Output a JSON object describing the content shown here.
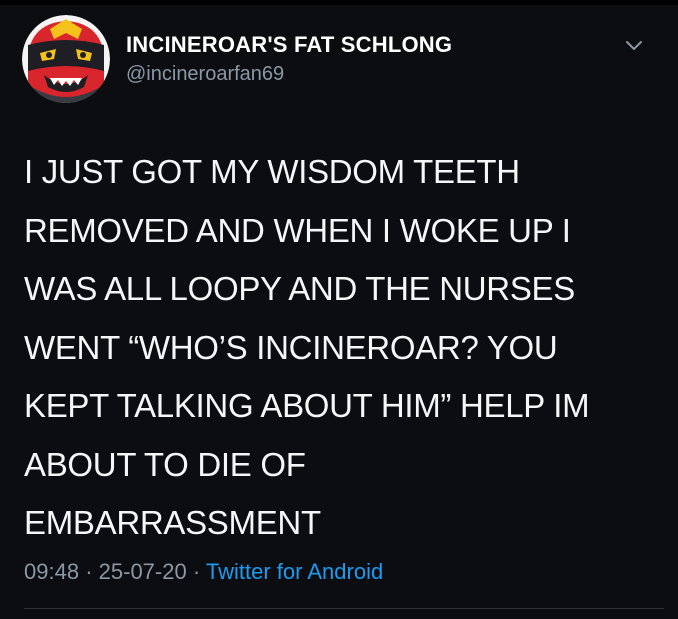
{
  "tweet": {
    "display_name": "INCINEROAR'S FAT SCHLONG",
    "handle": "@incineroarfan69",
    "text": "I JUST GOT MY WISDOM TEETH\nREMOVED AND WHEN I WOKE UP I\nWAS ALL LOOPY AND THE NURSES\nWENT “WHO’S INCINEROAR? YOU\nKEPT TALKING ABOUT HIM” HELP IM\nABOUT TO DIE OF\nEMBARRASSMENT",
    "time": "09:48",
    "separator": "·",
    "date": "25-07-20",
    "source": "Twitter for Android"
  },
  "icons": {
    "avatar": "incineroar-avatar",
    "menu": "chevron-down-icon"
  },
  "colors": {
    "background": "#0b0d11",
    "text": "#f5f6f7",
    "muted": "#8b98a5",
    "link": "#1d9bf0"
  }
}
